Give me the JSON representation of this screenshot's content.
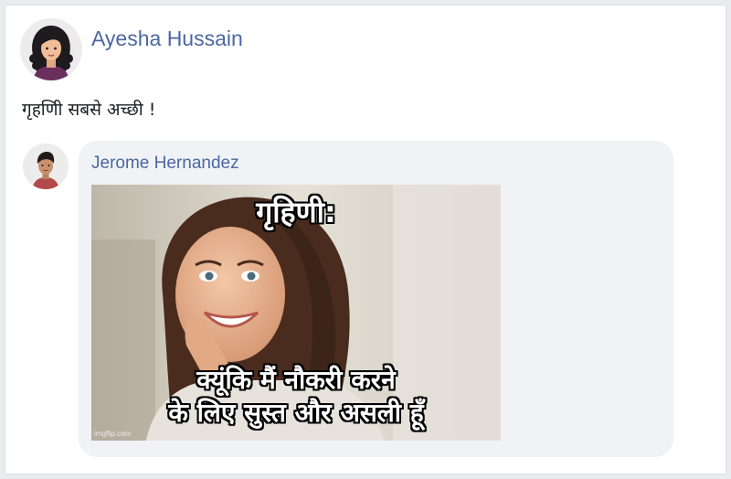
{
  "post": {
    "author_name": "Ayesha Hussain",
    "text": "गृहणिी सबसे अच्छी !"
  },
  "comment": {
    "author_name": "Jerome Hernandez",
    "meme": {
      "top_text": "गृहिणी:",
      "bottom_line_1": "क्यूंकि मैं नौकरी करने",
      "bottom_line_2": "के लिए सुस्त और असली हूँ",
      "watermark": "imgflip.com"
    }
  },
  "colors": {
    "name_link": "#4b67a1",
    "bubble_bg": "#f0f2f5",
    "page_bg": "#e9ebee"
  },
  "icons": {
    "post_avatar": "woman-avatar-icon",
    "comment_avatar": "man-avatar-icon"
  }
}
